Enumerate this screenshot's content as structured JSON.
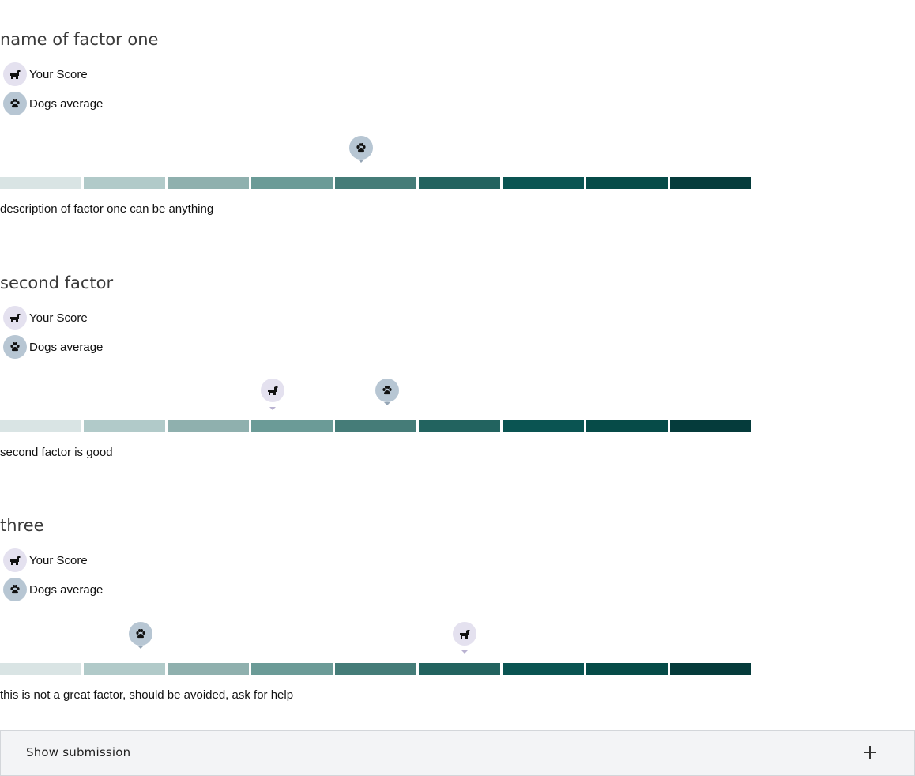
{
  "scale_colors": [
    "#d9e4e4",
    "#b1cac9",
    "#8fb0ae",
    "#6b9b97",
    "#457c78",
    "#22635f",
    "#0a5452",
    "#064b48",
    "#053b3b"
  ],
  "legend": {
    "score_label": "Your Score",
    "average_label": "Dogs average",
    "score_icon": "dog-icon",
    "average_icon": "paw-icon"
  },
  "factors": [
    {
      "title": "name of factor one",
      "description": "description of factor one can be anything",
      "score_step": null,
      "average_step": 5
    },
    {
      "title": "second factor",
      "description": "second factor is good",
      "score_step": 3.95,
      "average_step": 5.32
    },
    {
      "title": "three",
      "description": "this is not a great factor, should be avoided, ask for help",
      "score_step": 6.24,
      "average_step": 2.37
    }
  ],
  "submission": {
    "label": "Show submission",
    "icon": "plus-icon"
  }
}
